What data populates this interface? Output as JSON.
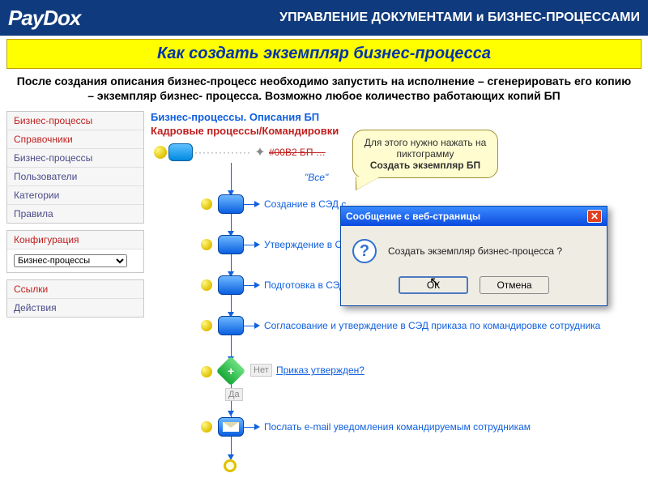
{
  "header": {
    "logo": "PayDox",
    "title": "УПРАВЛЕНИЕ ДОКУМЕНТАМИ и БИЗНЕС-ПРОЦЕССАМИ"
  },
  "yellowBar": "Как создать экземпляр бизнес-процесса",
  "intro": "После создания описания бизнес-процесс необходимо запустить на исполнение – сгенерировать его копию – экземпляр бизнес- процесса. Возможно любое количество работающих копий БП",
  "sidebar": {
    "groups": [
      {
        "rows": [
          {
            "label": "Бизнес-процессы",
            "red": true
          },
          {
            "label": "Справочники",
            "red": true
          },
          {
            "label": "Бизнес-процессы"
          },
          {
            "label": "Пользователи"
          },
          {
            "label": "Категории"
          },
          {
            "label": "Правила"
          }
        ]
      },
      {
        "rows": [
          {
            "label": "Конфигурация",
            "red": true
          }
        ],
        "select": "Бизнес-процессы"
      },
      {
        "rows": [
          {
            "label": "Ссылки",
            "red": true
          },
          {
            "label": "Действия"
          }
        ]
      }
    ]
  },
  "content": {
    "breadcrumb1": "Бизнес-процессы. Описания БП",
    "breadcrumb2": "Кадровые процессы/Командировки",
    "startCode": "#00B2 БП …",
    "vse": "\"Все\"",
    "steps": [
      "Создание в СЭД с",
      "Утверждение в СЭ",
      "Подготовка в СЭД",
      "Согласование и утверждение в СЭД приказа по командировке сотрудника"
    ],
    "decision": "Приказ утвержден?",
    "decNo": "Нет",
    "decYes": "Да",
    "lastStep": "Послать e-mail уведомления командируемым сотрудникам"
  },
  "callout": {
    "line1": "Для этого нужно нажать на пиктограмму",
    "strong": "Создать экземпляр БП"
  },
  "dialog": {
    "title": "Сообщение с веб-страницы",
    "text": "Создать экземпляр бизнес-процесса ?",
    "ok": "ОК",
    "cancel": "Отмена"
  }
}
